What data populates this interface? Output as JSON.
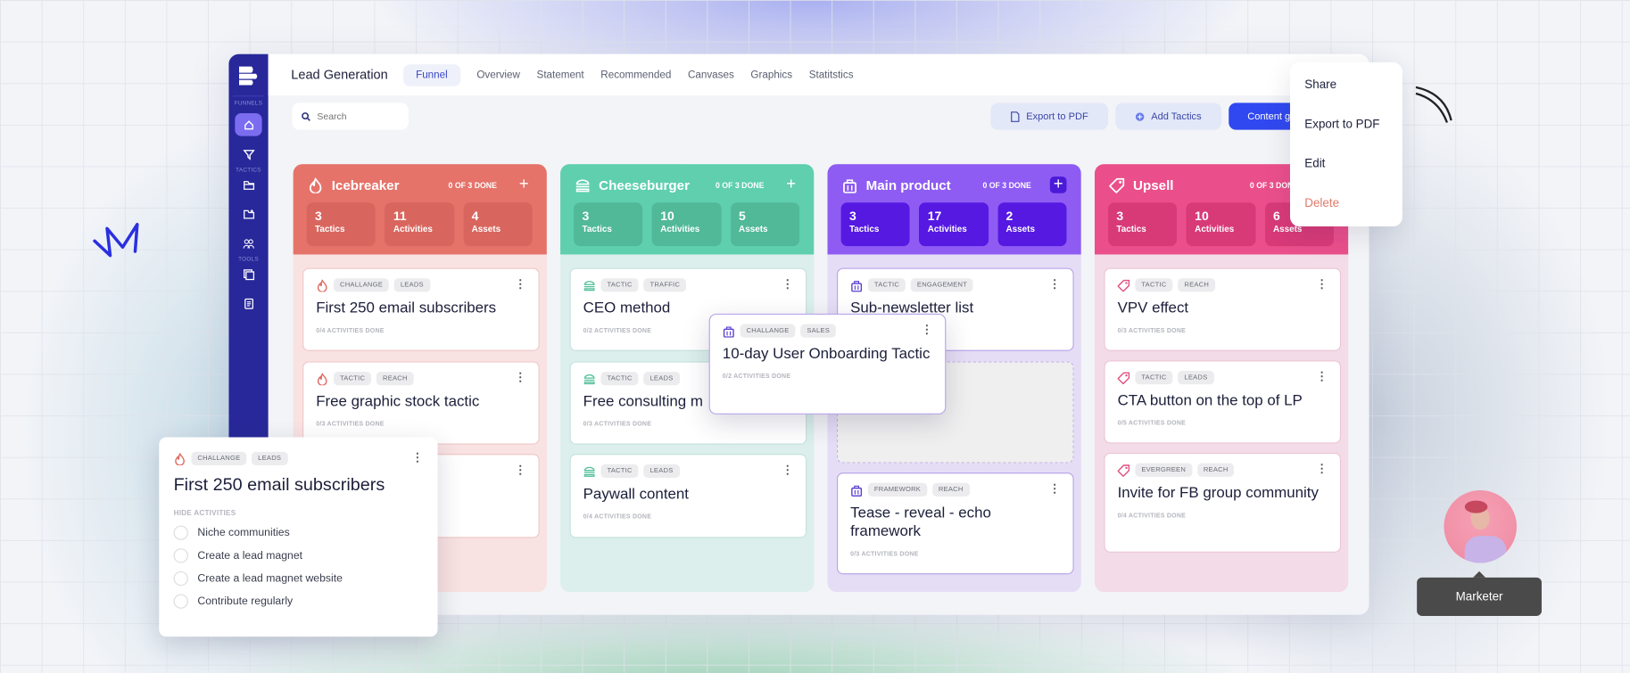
{
  "app": {
    "title": "Lead Generation"
  },
  "sidebar": {
    "sections": {
      "funnels": "FUNNELS",
      "tactics": "TACTICS",
      "tools": "TOOLS"
    },
    "items": [
      {
        "icon": "home-icon",
        "active": true
      },
      {
        "icon": "funnel-icon"
      },
      {
        "icon": "folder-icon"
      },
      {
        "icon": "folder-add-icon"
      },
      {
        "icon": "users-icon"
      },
      {
        "icon": "gallery-icon"
      },
      {
        "icon": "document-icon"
      }
    ]
  },
  "tabs": [
    "Funnel",
    "Overview",
    "Statement",
    "Recommended",
    "Canvases",
    "Graphics",
    "Statitstics"
  ],
  "active_tab": "Funnel",
  "search": {
    "placeholder": "Search",
    "value": ""
  },
  "toolbar": {
    "export_label": "Export to PDF",
    "add_tactics_label": "Add Tactics",
    "content_label": "Content g"
  },
  "menu": {
    "items": [
      "Share",
      "Export to PDF",
      "Edit",
      "Delete"
    ],
    "delete_color": "#e07a6a"
  },
  "columns": [
    {
      "name": "Icebreaker",
      "icon": "flame-icon",
      "done": "0 OF 3 DONE",
      "colors": {
        "head": "#e5736a",
        "stat": "#d9665e",
        "body": "#f9e2e2",
        "border": "#f0c9c9",
        "icon": "#e06b62"
      },
      "stats": [
        {
          "n": "3",
          "l": "Tactics"
        },
        {
          "n": "11",
          "l": "Activities"
        },
        {
          "n": "4",
          "l": "Assets"
        }
      ],
      "cards": [
        {
          "tags": [
            "CHALLANGE",
            "LEADS"
          ],
          "title": "First 250 email subscribers",
          "foot": "0/4 ACTIVITIES DONE"
        },
        {
          "tags": [
            "TACTIC",
            "REACH"
          ],
          "title": "Free graphic stock tactic",
          "foot": "0/3 ACTIVITIES DONE"
        },
        {
          "tags": [],
          "title": "",
          "foot": ""
        }
      ]
    },
    {
      "name": "Cheeseburger",
      "icon": "burger-icon",
      "done": "0 OF 3 DONE",
      "colors": {
        "head": "#5fcfae",
        "stat": "#51b998",
        "body": "#dcefec",
        "border": "#c5e3dc",
        "icon": "#4fbf98"
      },
      "stats": [
        {
          "n": "3",
          "l": "Tactics"
        },
        {
          "n": "10",
          "l": "Activities"
        },
        {
          "n": "5",
          "l": "Assets"
        }
      ],
      "cards": [
        {
          "tags": [
            "TACTIC",
            "TRAFFIC"
          ],
          "title": "CEO method",
          "foot": "0/2 ACTIVITIES DONE"
        },
        {
          "tags": [
            "TACTIC",
            "LEADS"
          ],
          "title": "Free consulting m",
          "foot": "0/3 ACTIVITIES DONE"
        },
        {
          "tags": [
            "TACTIC",
            "LEADS"
          ],
          "title": "Paywall content",
          "foot": "0/4 ACTIVITIES DONE"
        }
      ]
    },
    {
      "name": "Main product",
      "icon": "bag-icon",
      "done": "0 OF 3 DONE",
      "colors": {
        "head": "#8e5cf2",
        "stat": "#5519e2",
        "body": "#e5ddf5",
        "border": "#b9a6ea",
        "icon": "#5b3fd0"
      },
      "stats": [
        {
          "n": "3",
          "l": "Tactics"
        },
        {
          "n": "17",
          "l": "Activities"
        },
        {
          "n": "2",
          "l": "Assets"
        }
      ],
      "cards": [
        {
          "tags": [
            "TACTIC",
            "ENGAGEMENT"
          ],
          "title": "Sub-newsletter list",
          "foot": ""
        },
        {
          "tags": [
            "FRAMEWORK",
            "REACH"
          ],
          "title": "Tease - reveal - echo framework",
          "foot": "0/3 ACTIVITIES DONE"
        }
      ]
    },
    {
      "name": "Upsell",
      "icon": "tag-icon",
      "done": "0 OF 3 DONE",
      "colors": {
        "head": "#ea4f8b",
        "stat": "#d83a78",
        "body": "#f3dce7",
        "border": "#ecc5d6",
        "icon": "#e0507f"
      },
      "stats": [
        {
          "n": "3",
          "l": "Tactics"
        },
        {
          "n": "10",
          "l": "Activities"
        },
        {
          "n": "6",
          "l": "Assets"
        }
      ],
      "cards": [
        {
          "tags": [
            "TACTIC",
            "REACH"
          ],
          "title": "VPV effect",
          "foot": "0/3 ACTIVITIES DONE"
        },
        {
          "tags": [
            "TACTIC",
            "LEADS"
          ],
          "title": "CTA button on the top of LP",
          "foot": "0/5 ACTIVITIES DONE"
        },
        {
          "tags": [
            "EVERGREEN",
            "REACH"
          ],
          "title": "Invite for FB group community",
          "foot": "0/4 ACTIVITIES DONE"
        }
      ]
    }
  ],
  "drag_card": {
    "tags": [
      "CHALLANGE",
      "SALES"
    ],
    "title": "10-day User Onboarding Tactic",
    "foot": "0/2 ACTIVITIES DONE"
  },
  "expanded_card": {
    "tags": [
      "CHALLANGE",
      "LEADS"
    ],
    "title": "First 250 email subscribers",
    "toggle": "HIDE ACTIVITIES",
    "activities": [
      "Niche communities",
      "Create a lead magnet",
      "Create a lead magnet website",
      "Contribute regularly"
    ]
  },
  "user": {
    "role": "Marketer"
  }
}
